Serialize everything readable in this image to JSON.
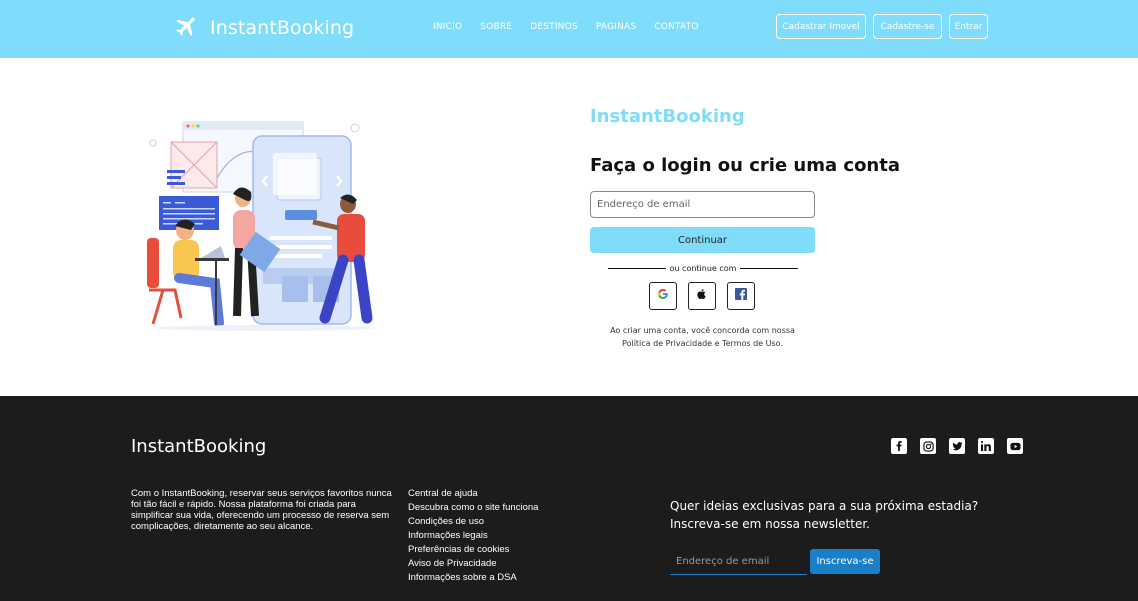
{
  "header": {
    "brand": "InstantBooking",
    "nav": [
      "INICIO",
      "SOBRE",
      "DESTINOS",
      "PAGINAS",
      "CONTATO"
    ],
    "buttons": {
      "register_property": "Cadastrar Imovel",
      "signup": "Cadastre-se",
      "login": "Entrar"
    },
    "colors": {
      "bar": "#7fdcfb"
    }
  },
  "login": {
    "brand": "InstantBooking",
    "title": "Faça o login ou crie uma conta",
    "email_placeholder": "Endereço de email",
    "continue_label": "Continuar",
    "divider_text": "ou continue com",
    "social": [
      "google-icon",
      "apple-icon",
      "facebook-icon"
    ],
    "terms_line1": "Ao criar uma conta, você concorda com nossa",
    "terms_line2": "Política de Privacidade e Termos de Uso."
  },
  "footer": {
    "brand": "InstantBooking",
    "about": "Com o InstantBooking, reservar seus serviços favoritos nunca foi tão fácil e rápido. Nossa plataforma foi criada para simplificar sua vida, oferecendo um processo de reserva sem complicações, diretamente ao seu alcance.",
    "links": [
      "Central de ajuda",
      "Descubra como o site funciona",
      "Condições de uso",
      "Informações legais",
      "Preferências de cookies",
      "Aviso de Privacidade",
      "Informações sobre a DSA"
    ],
    "social": [
      "facebook-icon",
      "instagram-icon",
      "twitter-icon",
      "linkedin-icon",
      "youtube-icon"
    ],
    "newsletter_line1": "Quer ideias exclusivas para a sua próxima estadia?",
    "newsletter_line2": "Inscreva-se em nossa newsletter.",
    "newsletter_placeholder": "Endereço de email",
    "subscribe_label": "Inscreva-se",
    "colors": {
      "background": "#1c1c1c",
      "accent": "#1a7fc7"
    }
  }
}
